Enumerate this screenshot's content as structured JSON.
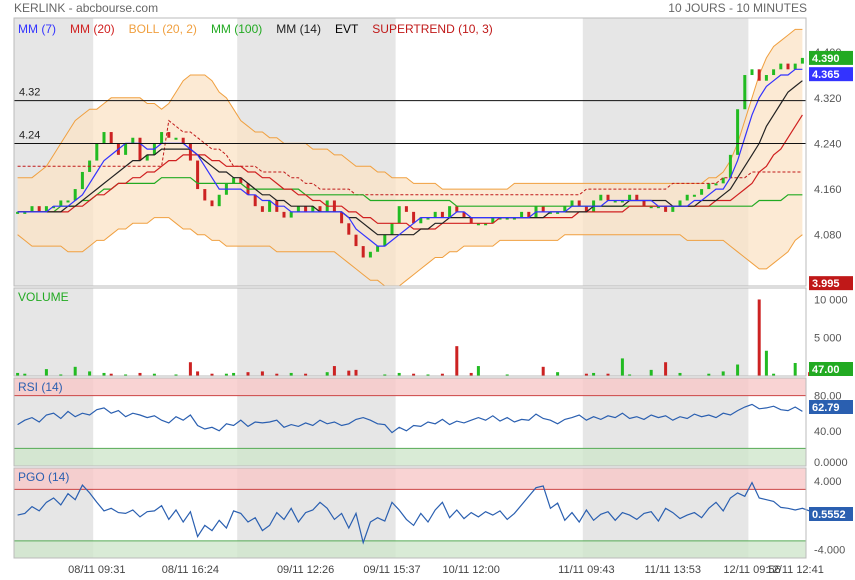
{
  "header": {
    "title": "KERLINK - abcbourse.com",
    "period": "10 JOURS - 10 MINUTES"
  },
  "colors": {
    "mm7": "#3333ff",
    "mm20": "#d02020",
    "boll": "#f0a040",
    "boll_fill": "#fbe3c6",
    "mm100": "#22aa22",
    "mm14": "#222222",
    "supertrend": "#c01818",
    "up": "#22bb22",
    "down": "#cc2222",
    "rsi_line": "#2a5fb0",
    "pgo_line": "#2a5fb0",
    "overbought_zone": "#f8c8c8",
    "oversold_zone": "#cfe6cc",
    "session_shade": "#e6e6e6"
  },
  "chart_data": [
    {
      "type": "line",
      "panel": "price",
      "legend": [
        "MM (7)",
        "MM (20)",
        "BOLL (20, 2)",
        "MM (100)",
        "MM (14)",
        "EVT",
        "SUPERTREND (10, 3)"
      ],
      "x_ticks": [
        "08/11 09:31",
        "08/11 16:24",
        "09/11 12:26",
        "09/11 15:37",
        "10/11 12:00",
        "11/11 09:43",
        "11/11 13:53",
        "12/11 09:56",
        "12/11 12:41"
      ],
      "y_ticks": [
        4.4,
        4.32,
        4.24,
        4.16,
        4.08,
        4.0
      ],
      "y_tick_labels": [
        "4.400",
        "4.320",
        "4.240",
        "4.160",
        "4.080",
        "4.000"
      ],
      "ylim": [
        3.99,
        4.46
      ],
      "hlines": [
        {
          "label": "4.32",
          "value": 4.315
        },
        {
          "label": "4.24",
          "value": 4.24
        }
      ],
      "price_badges": [
        {
          "label": "4.390",
          "value": 4.39,
          "color": "#22aa22"
        },
        {
          "label": "4.365",
          "value": 4.365,
          "color": "#3333ff"
        },
        {
          "label": "3.995",
          "value": 3.995,
          "color": "#c01818"
        }
      ],
      "close": [
        4.12,
        4.12,
        4.13,
        4.12,
        4.13,
        4.13,
        4.14,
        4.14,
        4.16,
        4.19,
        4.21,
        4.24,
        4.26,
        4.24,
        4.22,
        4.24,
        4.25,
        4.21,
        4.22,
        4.24,
        4.26,
        4.25,
        4.25,
        4.24,
        4.21,
        4.16,
        4.14,
        4.13,
        4.15,
        4.17,
        4.18,
        4.17,
        4.15,
        4.13,
        4.12,
        4.14,
        4.12,
        4.11,
        4.12,
        4.13,
        4.12,
        4.13,
        4.12,
        4.14,
        4.12,
        4.1,
        4.08,
        4.06,
        4.04,
        4.05,
        4.06,
        4.08,
        4.1,
        4.13,
        4.12,
        4.1,
        4.11,
        4.11,
        4.12,
        4.11,
        4.13,
        4.12,
        4.11,
        4.1,
        4.1,
        4.1,
        4.11,
        4.11,
        4.11,
        4.11,
        4.12,
        4.11,
        4.13,
        4.12,
        4.12,
        4.12,
        4.13,
        4.14,
        4.13,
        4.12,
        4.14,
        4.15,
        4.14,
        4.14,
        4.14,
        4.15,
        4.14,
        4.13,
        4.13,
        4.13,
        4.12,
        4.13,
        4.14,
        4.15,
        4.15,
        4.16,
        4.17,
        4.17,
        4.18,
        4.22,
        4.3,
        4.36,
        4.37,
        4.35,
        4.36,
        4.37,
        4.38,
        4.37,
        4.38,
        4.39
      ],
      "mm7": [
        4.12,
        4.12,
        4.12,
        4.12,
        4.12,
        4.13,
        4.13,
        4.13,
        4.14,
        4.15,
        4.17,
        4.19,
        4.21,
        4.22,
        4.23,
        4.24,
        4.24,
        4.24,
        4.23,
        4.23,
        4.24,
        4.24,
        4.24,
        4.24,
        4.23,
        4.22,
        4.2,
        4.18,
        4.16,
        4.16,
        4.16,
        4.16,
        4.15,
        4.15,
        4.14,
        4.14,
        4.13,
        4.13,
        4.12,
        4.12,
        4.12,
        4.12,
        4.12,
        4.12,
        4.12,
        4.12,
        4.11,
        4.09,
        4.08,
        4.07,
        4.06,
        4.06,
        4.07,
        4.08,
        4.09,
        4.1,
        4.11,
        4.11,
        4.11,
        4.11,
        4.11,
        4.12,
        4.12,
        4.11,
        4.11,
        4.11,
        4.11,
        4.11,
        4.11,
        4.11,
        4.11,
        4.11,
        4.12,
        4.12,
        4.12,
        4.12,
        4.12,
        4.13,
        4.13,
        4.13,
        4.13,
        4.13,
        4.14,
        4.14,
        4.14,
        4.14,
        4.14,
        4.14,
        4.14,
        4.13,
        4.13,
        4.13,
        4.13,
        4.13,
        4.14,
        4.14,
        4.15,
        4.16,
        4.16,
        4.18,
        4.21,
        4.25,
        4.29,
        4.32,
        4.34,
        4.35,
        4.36,
        4.36,
        4.37,
        4.37
      ],
      "mm14": [
        4.12,
        4.12,
        4.12,
        4.12,
        4.12,
        4.12,
        4.12,
        4.13,
        4.13,
        4.14,
        4.15,
        4.16,
        4.17,
        4.18,
        4.19,
        4.2,
        4.21,
        4.21,
        4.22,
        4.22,
        4.23,
        4.23,
        4.23,
        4.23,
        4.23,
        4.22,
        4.21,
        4.2,
        4.19,
        4.19,
        4.18,
        4.18,
        4.17,
        4.16,
        4.15,
        4.15,
        4.14,
        4.14,
        4.13,
        4.13,
        4.13,
        4.13,
        4.12,
        4.12,
        4.12,
        4.12,
        4.11,
        4.11,
        4.1,
        4.09,
        4.08,
        4.08,
        4.08,
        4.08,
        4.08,
        4.08,
        4.09,
        4.09,
        4.1,
        4.1,
        4.11,
        4.11,
        4.11,
        4.11,
        4.11,
        4.11,
        4.11,
        4.11,
        4.11,
        4.11,
        4.11,
        4.11,
        4.11,
        4.11,
        4.12,
        4.12,
        4.12,
        4.12,
        4.12,
        4.12,
        4.13,
        4.13,
        4.13,
        4.13,
        4.13,
        4.14,
        4.14,
        4.14,
        4.14,
        4.14,
        4.14,
        4.13,
        4.13,
        4.13,
        4.13,
        4.14,
        4.14,
        4.14,
        4.15,
        4.16,
        4.18,
        4.2,
        4.22,
        4.24,
        4.27,
        4.29,
        4.31,
        4.33,
        4.34,
        4.35
      ],
      "mm20": [
        4.12,
        4.12,
        4.12,
        4.12,
        4.12,
        4.12,
        4.12,
        4.12,
        4.13,
        4.13,
        4.14,
        4.15,
        4.15,
        4.16,
        4.17,
        4.17,
        4.18,
        4.18,
        4.19,
        4.19,
        4.2,
        4.21,
        4.21,
        4.22,
        4.22,
        4.22,
        4.22,
        4.21,
        4.21,
        4.2,
        4.2,
        4.2,
        4.19,
        4.19,
        4.18,
        4.18,
        4.17,
        4.16,
        4.16,
        4.15,
        4.15,
        4.14,
        4.14,
        4.13,
        4.13,
        4.13,
        4.12,
        4.12,
        4.11,
        4.11,
        4.1,
        4.1,
        4.1,
        4.1,
        4.1,
        4.09,
        4.09,
        4.09,
        4.09,
        4.1,
        4.1,
        4.1,
        4.1,
        4.1,
        4.1,
        4.1,
        4.1,
        4.11,
        4.11,
        4.11,
        4.11,
        4.11,
        4.11,
        4.11,
        4.11,
        4.11,
        4.11,
        4.11,
        4.12,
        4.12,
        4.12,
        4.12,
        4.12,
        4.12,
        4.12,
        4.13,
        4.13,
        4.13,
        4.13,
        4.13,
        4.13,
        4.13,
        4.13,
        4.13,
        4.13,
        4.13,
        4.13,
        4.14,
        4.14,
        4.14,
        4.15,
        4.16,
        4.17,
        4.19,
        4.2,
        4.22,
        4.23,
        4.25,
        4.27,
        4.29
      ],
      "mm100": [
        4.12,
        4.12,
        4.12,
        4.12,
        4.12,
        4.12,
        4.13,
        4.13,
        4.13,
        4.14,
        4.14,
        4.15,
        4.16,
        4.16,
        4.17,
        4.17,
        4.17,
        4.17,
        4.17,
        4.17,
        4.18,
        4.18,
        4.18,
        4.18,
        4.18,
        4.17,
        4.17,
        4.17,
        4.17,
        4.17,
        4.17,
        4.17,
        4.16,
        4.16,
        4.16,
        4.16,
        4.16,
        4.16,
        4.16,
        4.16,
        4.15,
        4.15,
        4.15,
        4.15,
        4.15,
        4.15,
        4.15,
        4.15,
        4.15,
        4.14,
        4.14,
        4.14,
        4.14,
        4.14,
        4.14,
        4.14,
        4.14,
        4.14,
        4.14,
        4.14,
        4.14,
        4.13,
        4.13,
        4.13,
        4.13,
        4.13,
        4.13,
        4.13,
        4.13,
        4.13,
        4.13,
        4.13,
        4.13,
        4.13,
        4.13,
        4.13,
        4.13,
        4.13,
        4.13,
        4.13,
        4.13,
        4.13,
        4.13,
        4.13,
        4.13,
        4.13,
        4.13,
        4.13,
        4.13,
        4.13,
        4.13,
        4.13,
        4.13,
        4.13,
        4.13,
        4.13,
        4.13,
        4.13,
        4.13,
        4.13,
        4.13,
        4.13,
        4.13,
        4.14,
        4.14,
        4.14,
        4.14,
        4.15,
        4.15,
        4.15
      ],
      "boll_upper": [
        4.18,
        4.18,
        4.18,
        4.19,
        4.2,
        4.22,
        4.24,
        4.26,
        4.28,
        4.29,
        4.3,
        4.3,
        4.31,
        4.32,
        4.32,
        4.32,
        4.32,
        4.32,
        4.31,
        4.31,
        4.3,
        4.31,
        4.33,
        4.35,
        4.36,
        4.36,
        4.36,
        4.35,
        4.33,
        4.32,
        4.3,
        4.28,
        4.27,
        4.26,
        4.26,
        4.25,
        4.25,
        4.24,
        4.24,
        4.24,
        4.24,
        4.23,
        4.23,
        4.23,
        4.22,
        4.22,
        4.21,
        4.2,
        4.2,
        4.2,
        4.19,
        4.19,
        4.18,
        4.18,
        4.18,
        4.17,
        4.17,
        4.17,
        4.17,
        4.16,
        4.16,
        4.16,
        4.16,
        4.16,
        4.16,
        4.16,
        4.16,
        4.16,
        4.16,
        4.17,
        4.17,
        4.17,
        4.17,
        4.17,
        4.17,
        4.17,
        4.17,
        4.17,
        4.17,
        4.17,
        4.17,
        4.17,
        4.17,
        4.17,
        4.17,
        4.17,
        4.17,
        4.17,
        4.17,
        4.17,
        4.17,
        4.17,
        4.17,
        4.17,
        4.17,
        4.17,
        4.18,
        4.18,
        4.19,
        4.21,
        4.24,
        4.28,
        4.32,
        4.36,
        4.39,
        4.41,
        4.42,
        4.43,
        4.44,
        4.44
      ],
      "boll_lower": [
        4.08,
        4.07,
        4.06,
        4.06,
        4.06,
        4.06,
        4.06,
        4.05,
        4.05,
        4.05,
        4.06,
        4.07,
        4.07,
        4.08,
        4.09,
        4.09,
        4.1,
        4.1,
        4.1,
        4.11,
        4.11,
        4.11,
        4.1,
        4.09,
        4.09,
        4.08,
        4.08,
        4.07,
        4.07,
        4.06,
        4.06,
        4.06,
        4.06,
        4.06,
        4.06,
        4.06,
        4.05,
        4.05,
        4.05,
        4.05,
        4.05,
        4.05,
        4.05,
        4.05,
        4.05,
        4.04,
        4.03,
        4.02,
        4.01,
        4.0,
        4.0,
        3.99,
        3.99,
        3.99,
        4.0,
        4.01,
        4.02,
        4.03,
        4.04,
        4.04,
        4.05,
        4.05,
        4.06,
        4.06,
        4.06,
        4.06,
        4.06,
        4.07,
        4.07,
        4.07,
        4.07,
        4.07,
        4.07,
        4.07,
        4.07,
        4.07,
        4.08,
        4.08,
        4.08,
        4.08,
        4.08,
        4.08,
        4.08,
        4.08,
        4.08,
        4.08,
        4.08,
        4.08,
        4.08,
        4.08,
        4.08,
        4.08,
        4.08,
        4.07,
        4.07,
        4.07,
        4.07,
        4.07,
        4.07,
        4.06,
        4.05,
        4.04,
        4.03,
        4.02,
        4.02,
        4.03,
        4.04,
        4.05,
        4.07,
        4.08
      ],
      "supertrend": [
        4.2,
        4.2,
        4.2,
        4.2,
        4.2,
        4.2,
        4.2,
        4.2,
        4.2,
        4.2,
        4.2,
        4.2,
        4.2,
        4.2,
        4.2,
        4.2,
        4.2,
        4.2,
        4.2,
        4.2,
        4.2,
        4.28,
        4.27,
        4.26,
        4.26,
        4.25,
        4.24,
        4.23,
        4.23,
        4.22,
        4.2,
        4.2,
        4.2,
        4.2,
        4.19,
        4.19,
        4.19,
        4.19,
        4.18,
        4.18,
        4.17,
        4.17,
        4.16,
        4.16,
        4.16,
        4.16,
        4.16,
        4.15,
        4.15,
        4.15,
        4.15,
        4.15,
        4.15,
        4.15,
        4.15,
        4.15,
        4.15,
        4.15,
        4.15,
        4.15,
        4.15,
        4.15,
        4.15,
        4.15,
        4.15,
        4.15,
        4.15,
        4.15,
        4.15,
        4.15,
        4.15,
        4.15,
        4.15,
        4.15,
        4.15,
        4.15,
        4.15,
        4.15,
        4.15,
        4.16,
        4.16,
        4.16,
        4.16,
        4.16,
        4.16,
        4.16,
        4.16,
        4.16,
        4.16,
        4.16,
        4.16,
        4.17,
        4.17,
        4.17,
        4.17,
        4.17,
        4.17,
        4.17,
        4.18,
        4.18,
        4.18,
        4.18,
        4.19,
        4.19,
        4.19,
        4.19,
        4.19,
        4.19,
        4.19,
        4.19
      ]
    },
    {
      "type": "bar",
      "panel": "volume",
      "label": "VOLUME",
      "y_ticks": [
        10000,
        5000,
        0
      ],
      "y_tick_labels": [
        "10 000",
        "5 000",
        ""
      ],
      "ylim": [
        0,
        11500
      ],
      "badge": {
        "label": "47.00",
        "color": "#22aa22"
      },
      "values": [
        400,
        300,
        0,
        0,
        900,
        0,
        200,
        0,
        1200,
        0,
        600,
        0,
        400,
        300,
        0,
        200,
        0,
        400,
        0,
        300,
        0,
        0,
        200,
        0,
        1800,
        600,
        0,
        300,
        0,
        300,
        400,
        0,
        500,
        0,
        600,
        0,
        300,
        0,
        400,
        0,
        300,
        0,
        0,
        500,
        1300,
        0,
        700,
        800,
        0,
        0,
        0,
        200,
        0,
        400,
        0,
        300,
        0,
        200,
        0,
        300,
        0,
        3900,
        0,
        400,
        1300,
        0,
        0,
        0,
        200,
        0,
        0,
        0,
        0,
        1200,
        0,
        500,
        0,
        0,
        0,
        300,
        400,
        0,
        300,
        0,
        2300,
        200,
        0,
        0,
        800,
        0,
        1800,
        0,
        400,
        0,
        0,
        0,
        300,
        0,
        600,
        0,
        1500,
        0,
        0,
        10000,
        3300,
        300,
        0,
        0,
        1700,
        0,
        500
      ]
    },
    {
      "type": "line",
      "panel": "rsi",
      "label": "RSI (14)",
      "y_ticks": [
        80,
        40,
        0
      ],
      "y_tick_labels": [
        "80.00",
        "40.00",
        "0.0000"
      ],
      "ylim": [
        0,
        100
      ],
      "zones": {
        "overbought": 80,
        "oversold": 20
      },
      "badge": {
        "label": "62.79",
        "color": "#2a5fb0"
      },
      "values": [
        47,
        52,
        55,
        50,
        58,
        60,
        54,
        62,
        56,
        60,
        58,
        64,
        66,
        60,
        63,
        56,
        60,
        58,
        55,
        57,
        52,
        49,
        56,
        52,
        58,
        46,
        42,
        44,
        40,
        48,
        46,
        52,
        45,
        50,
        49,
        50,
        52,
        44,
        47,
        45,
        49,
        46,
        52,
        48,
        50,
        46,
        48,
        53,
        55,
        52,
        48,
        47,
        38,
        44,
        40,
        46,
        45,
        50,
        48,
        53,
        47,
        51,
        49,
        52,
        55,
        52,
        57,
        51,
        55,
        50,
        53,
        52,
        59,
        54,
        52,
        48,
        53,
        55,
        58,
        52,
        56,
        53,
        57,
        55,
        60,
        54,
        56,
        53,
        58,
        55,
        57,
        52,
        56,
        54,
        59,
        56,
        58,
        55,
        60,
        58,
        63,
        67,
        70,
        65,
        66,
        68,
        64,
        63,
        67,
        62
      ]
    },
    {
      "type": "line",
      "panel": "pgo",
      "label": "PGO (14)",
      "y_ticks": [
        4,
        0,
        -4
      ],
      "y_tick_labels": [
        "4.000",
        "",
        "-4.000"
      ],
      "ylim": [
        -5,
        5.5
      ],
      "zones": {
        "overbought": 3,
        "oversold": -3
      },
      "badge": {
        "label": "0.5552",
        "color": "#2a5fb0"
      },
      "values": [
        0,
        0.2,
        1,
        0.5,
        1.5,
        2,
        1.2,
        2.5,
        1.8,
        3.5,
        2.6,
        1.5,
        0.5,
        0.8,
        0.3,
        0.2,
        0.6,
        -0.2,
        0.4,
        0.5,
        1.1,
        -0.5,
        0.6,
        -0.8,
        0.4,
        -2.5,
        -1.2,
        -1.8,
        -0.6,
        -1.5,
        0.5,
        0.2,
        -0.8,
        -0.3,
        -1.8,
        -1.2,
        0.3,
        -0.5,
        0.8,
        -0.8,
        0.3,
        0.6,
        1.5,
        0.8,
        -0.5,
        0.2,
        -1.5,
        0.2,
        -3.2,
        -0.8,
        -0.3,
        -0.7,
        1.5,
        0.6,
        -0.5,
        -1.2,
        0.2,
        -0.8,
        0.6,
        1.5,
        -0.3,
        0.6,
        -0.4,
        0.3,
        -0.2,
        0.4,
        0,
        0.5,
        -0.5,
        0.2,
        1.2,
        2.2,
        3.2,
        3.4,
        0.8,
        1.4,
        -0.6,
        0.3,
        -0.8,
        0.6,
        -0.6,
        0.1,
        0.4,
        -0.6,
        0.3,
        0,
        -0.5,
        0.2,
        0.4,
        -0.7,
        0.8,
        0.3,
        -0.4,
        0,
        0.3,
        -0.3,
        0.8,
        1.5,
        0.5,
        2,
        2.6,
        2.2,
        3.8,
        2,
        1.8,
        1.6,
        0.9,
        0.8,
        0.6,
        0.8,
        0.5
      ]
    }
  ]
}
